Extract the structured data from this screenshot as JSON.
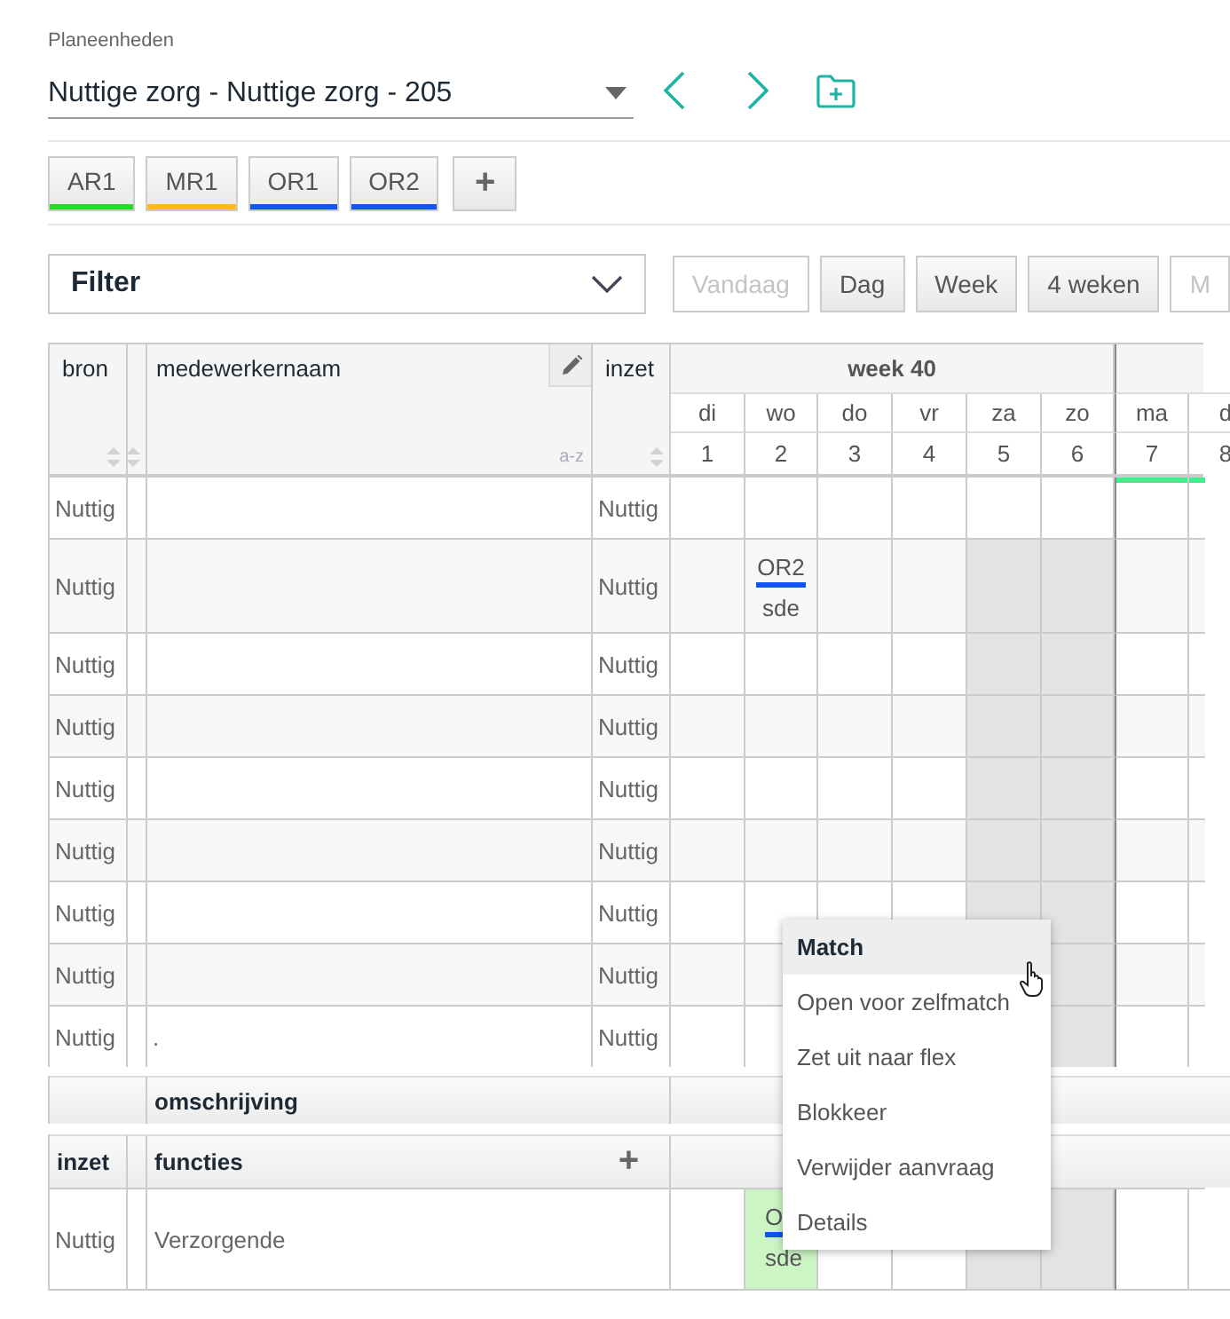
{
  "planning_unit": {
    "label": "Planeenheden",
    "value": "Nuttige zorg - Nuttige zorg - 205"
  },
  "tags": [
    {
      "label": "AR1",
      "color": "#22dd22"
    },
    {
      "label": "MR1",
      "color": "#ffbb11"
    },
    {
      "label": "OR1",
      "color": "#1155ee"
    },
    {
      "label": "OR2",
      "color": "#1155ee"
    }
  ],
  "add_tag": {
    "label": "+"
  },
  "filter": {
    "label": "Filter"
  },
  "view_buttons": [
    {
      "label": "Vandaag",
      "disabled": true
    },
    {
      "label": "Dag",
      "disabled": false
    },
    {
      "label": "Week",
      "disabled": false
    },
    {
      "label": "4 weken",
      "disabled": false
    },
    {
      "label": "M",
      "disabled": true
    }
  ],
  "schedule": {
    "columns": {
      "source": "bron",
      "employee": "medewerkernaam",
      "deployment": "inzet"
    },
    "sort_label": "a-z",
    "weeks": [
      {
        "label": "week 40",
        "days": [
          {
            "name": "di",
            "number": "1",
            "weekend": false,
            "today": false
          },
          {
            "name": "wo",
            "number": "2",
            "weekend": false,
            "today": false
          },
          {
            "name": "do",
            "number": "3",
            "weekend": false,
            "today": false
          },
          {
            "name": "vr",
            "number": "4",
            "weekend": false,
            "today": false
          },
          {
            "name": "za",
            "number": "5",
            "weekend": true,
            "today": false
          },
          {
            "name": "zo",
            "number": "6",
            "weekend": true,
            "today": false
          }
        ]
      },
      {
        "days": [
          {
            "name": "ma",
            "number": "7",
            "weekend": false,
            "today": true
          },
          {
            "name": "d",
            "number": "8",
            "weekend": false,
            "today": true
          }
        ]
      }
    ],
    "rows": [
      {
        "source": "Nuttig",
        "deployment": "Nuttig",
        "cells": [
          {},
          {},
          {},
          {},
          {},
          {},
          {},
          {}
        ]
      },
      {
        "source": "Nuttig",
        "deployment": "Nuttig",
        "cells": [
          {},
          {
            "code": "OR2",
            "subtext": "sde",
            "color": "#1155ee"
          },
          {},
          {},
          {},
          {},
          {},
          {}
        ]
      },
      {
        "source": "Nuttig",
        "deployment": "Nuttig",
        "cells": [
          {},
          {},
          {},
          {},
          {},
          {},
          {},
          {}
        ]
      },
      {
        "source": "Nuttig",
        "deployment": "Nuttig",
        "cells": [
          {},
          {},
          {},
          {},
          {},
          {},
          {},
          {}
        ]
      },
      {
        "source": "Nuttig",
        "deployment": "Nuttig",
        "cells": [
          {},
          {},
          {},
          {},
          {},
          {},
          {},
          {}
        ]
      },
      {
        "source": "Nuttig",
        "deployment": "Nuttig",
        "cells": [
          {},
          {},
          {},
          {},
          {},
          {},
          {},
          {}
        ]
      },
      {
        "source": "Nuttig",
        "deployment": "Nuttig",
        "cells": [
          {},
          {},
          {},
          {},
          {},
          {},
          {},
          {}
        ]
      },
      {
        "source": "Nuttig",
        "deployment": "Nuttig",
        "cells": [
          {},
          {},
          {},
          {},
          {},
          {},
          {},
          {}
        ]
      },
      {
        "source": "Nuttig",
        "employee": ".",
        "deployment": "Nuttig",
        "cells": [
          {},
          {},
          {},
          {},
          {},
          {},
          {},
          {}
        ]
      }
    ]
  },
  "description": {
    "label": "omschrijving"
  },
  "functions": {
    "columns": {
      "deployment": "inzet",
      "function": "functies"
    },
    "add_label": "+",
    "rows": [
      {
        "deployment": "Nuttig",
        "function": "Verzorgende",
        "cells": [
          {},
          {
            "code": "O",
            "subtext": "sde",
            "color": "#1155ee",
            "requested": true
          },
          {},
          {},
          {},
          {},
          {},
          {}
        ]
      }
    ]
  },
  "context_menu": [
    {
      "label": "Match",
      "selected": true
    },
    {
      "label": "Open voor zelfmatch",
      "selected": false
    },
    {
      "label": "Zet uit naar flex",
      "selected": false
    },
    {
      "label": "Blokkeer",
      "selected": false
    },
    {
      "label": "Verwijder aanvraag",
      "selected": false
    },
    {
      "label": "Details",
      "selected": false
    }
  ]
}
